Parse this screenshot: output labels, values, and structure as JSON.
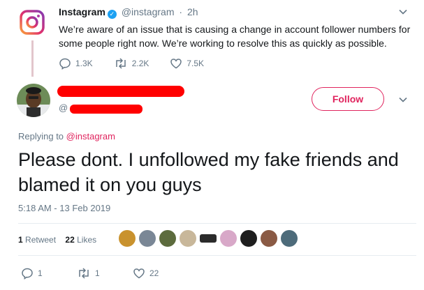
{
  "quoted_tweet": {
    "display_name": "Instagram",
    "handle": "@instagram",
    "separator": "·",
    "time": "2h",
    "text": "We’re aware of an issue that is causing a change in account follower numbers for some people right now. We’re working to resolve this as quickly as possible.",
    "replies": "1.3K",
    "retweets": "2.2K",
    "likes": "7.5K"
  },
  "reply_tweet": {
    "handle_prefix": "@",
    "follow_label": "Follow",
    "replying_to_label": "Replying to",
    "replying_to_handle": "@instagram",
    "text": "Please dont. I unfollowed my fake friends and blamed it on you guys",
    "timestamp": "5:18 AM - 13 Feb 2019",
    "retweet_count": "1",
    "retweet_label": "Retweet",
    "like_count": "22",
    "like_label": "Likes",
    "actions": {
      "replies": "1",
      "retweets": "1",
      "likes": "22"
    }
  },
  "icons": [
    "instagram-logo-icon",
    "verified-badge-icon",
    "chevron-down-icon",
    "reply-icon",
    "retweet-icon",
    "heart-icon"
  ],
  "colors": {
    "accent": "#e0245e",
    "verified": "#1da1f2",
    "redaction": "#ff0000",
    "muted_text": "#657786"
  }
}
